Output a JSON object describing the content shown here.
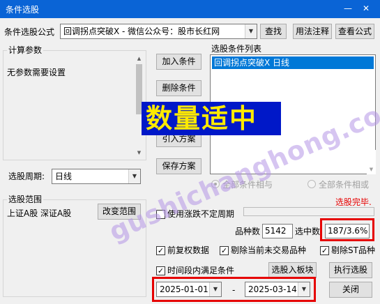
{
  "window": {
    "title": "条件选股",
    "minimize_icon": "minimize-icon",
    "close_icon": "close-icon"
  },
  "formula": {
    "label": "条件选股公式",
    "selected": "回调拐点突破X  -  微信公众号：股市长红网",
    "find_button": "查找",
    "usage_button": "用法注释",
    "view_button": "查看公式"
  },
  "params": {
    "title": "计算参数",
    "text": "无参数需要设置"
  },
  "actions": {
    "add": "加入条件",
    "delete": "删除条件",
    "import": "引入方案",
    "save": "保存方案"
  },
  "conditions": {
    "title": "选股条件列表",
    "items": [
      "回调拐点突破X  日线"
    ],
    "and_label": "全部条件相与",
    "or_label": "全部条件相或"
  },
  "period": {
    "label": "选股周期:",
    "value": "日线"
  },
  "scope": {
    "title": "选股范围",
    "text": "上证A股 深证A股",
    "button": "改变范围"
  },
  "status": {
    "done": "选股完毕."
  },
  "options": {
    "irregular_period": "使用涨跌不定周期",
    "adjusted": "前复权数据",
    "exclude_untraded": "剔除当前未交易品种",
    "exclude_st": "剔除ST品种",
    "time_range": "时间段内满足条件"
  },
  "stats": {
    "count_label": "品种数",
    "count_value": "5142",
    "selected_label": "选中数",
    "selected_value": "187/3.6%"
  },
  "dates": {
    "start": "2025-01-01",
    "separator": "-",
    "end": "2025-03-14"
  },
  "buttons": {
    "to_block": "选股入板块",
    "execute": "执行选股",
    "close": "关闭"
  },
  "overlay": {
    "caption": "数量适中",
    "watermark": "gushichanghong.com"
  },
  "colors": {
    "titlebar": "#0a64d6",
    "selection": "#0078d7",
    "highlight": "#e60000",
    "overlay_bg": "#0018c8",
    "overlay_text": "#ffe900"
  }
}
